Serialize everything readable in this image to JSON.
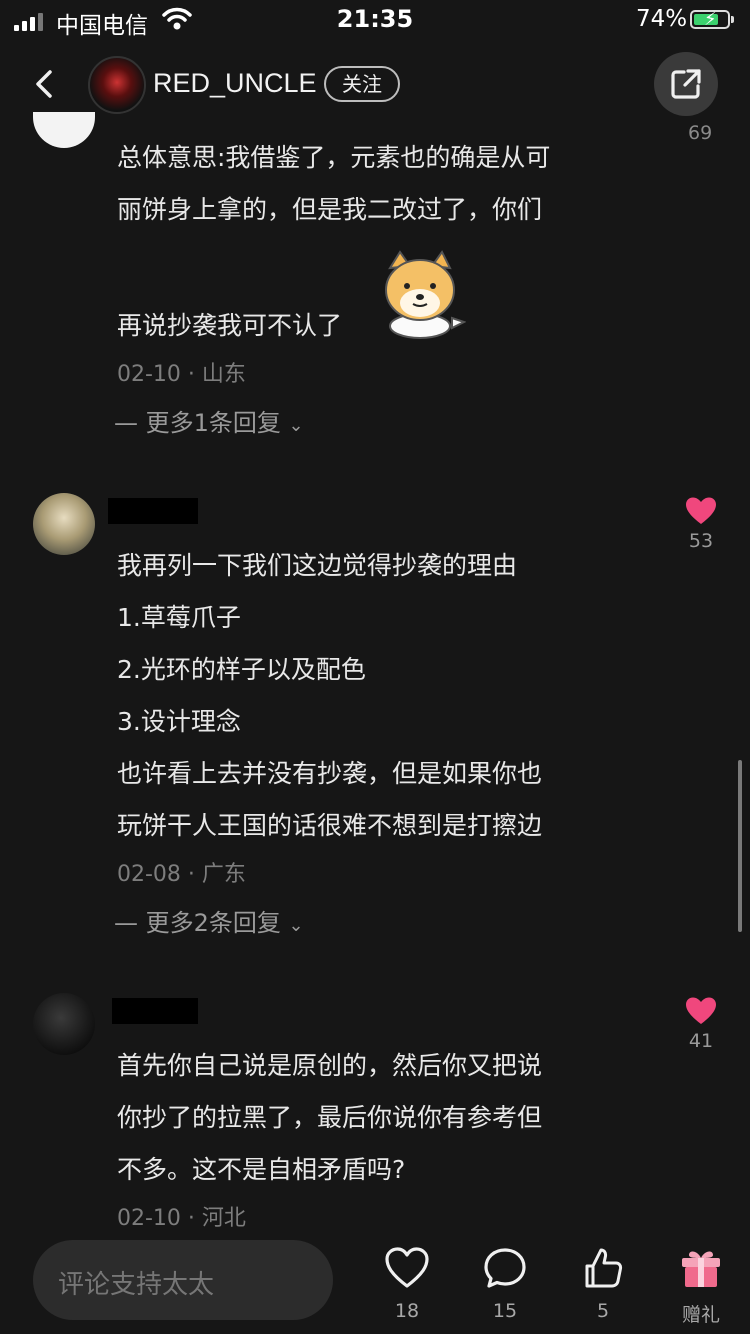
{
  "status_bar": {
    "carrier": "中国电信",
    "time": "21:35",
    "battery": "74%"
  },
  "header": {
    "username": "RED_UNCLE",
    "follow_label": "关注"
  },
  "partial_like_count": "69",
  "comments": [
    {
      "lines": [
        "总体意思:我借鉴了，元素也的确是从可",
        "丽饼身上拿的，但是我二改过了，你们",
        "再说抄袭我可不认了"
      ],
      "meta": "02-10 · 山东",
      "more_replies": "— 更多1条回复"
    },
    {
      "likes": "53",
      "lines": [
        "我再列一下我们这边觉得抄袭的理由",
        "1.草莓爪子",
        "2.光环的样子以及配色",
        "3.设计理念",
        "也许看上去并没有抄袭，但是如果你也",
        "玩饼干人王国的话很难不想到是打擦边"
      ],
      "meta": "02-08 · 广东",
      "more_replies": "— 更多2条回复"
    },
    {
      "likes": "41",
      "lines": [
        "首先你自己说是原创的，然后你又把说",
        "你抄了的拉黑了，最后你说你有参考但",
        "不多。这不是自相矛盾吗?"
      ],
      "meta": "02-10 · 河北"
    }
  ],
  "bottom_bar": {
    "input_placeholder": "评论支持太太",
    "like_count": "18",
    "comment_count": "15",
    "thumb_count": "5",
    "gift_label": "赠礼"
  },
  "colors": {
    "heart": "#f0477d",
    "background": "#161616",
    "gift": "#f06a8c"
  }
}
